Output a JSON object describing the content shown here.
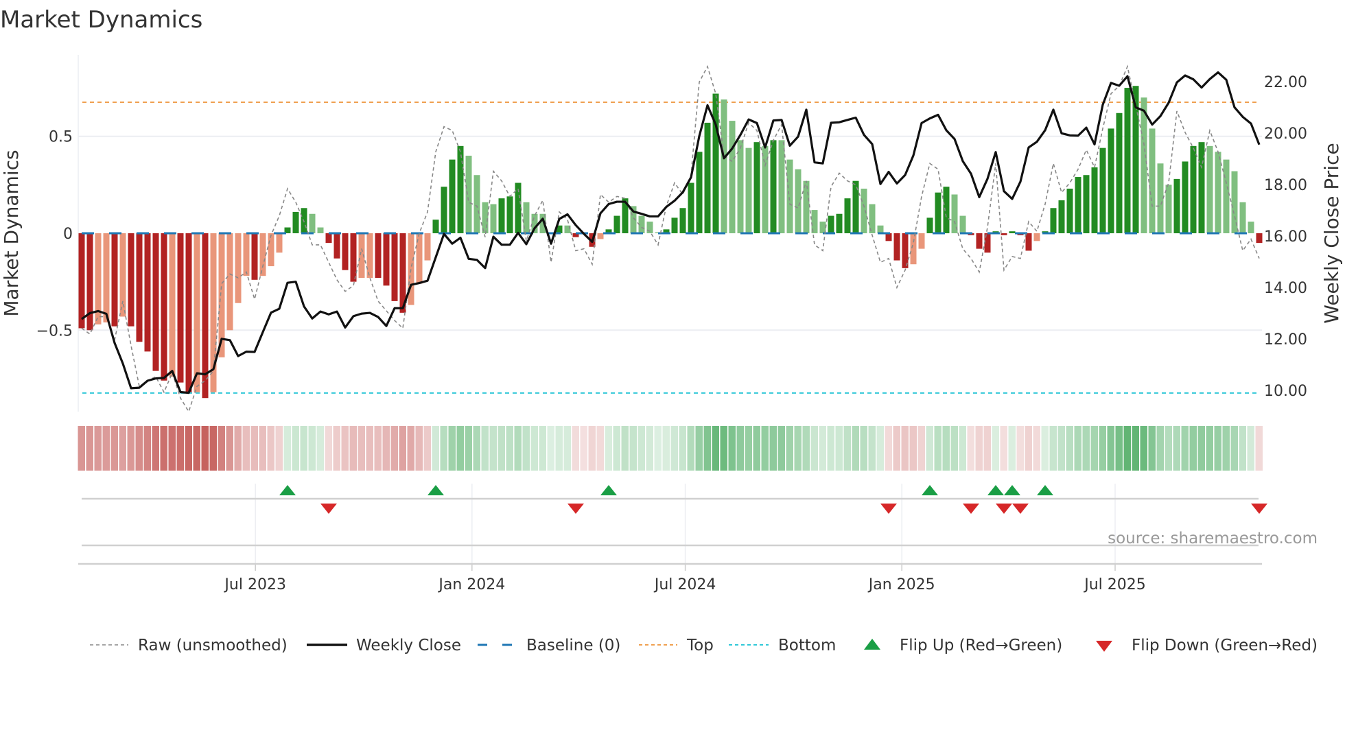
{
  "chart_data": {
    "type": "bar",
    "title": "Market Dynamics",
    "ylabel": "Market Dynamics",
    "y2label": "Weekly Close Price",
    "ylim": [
      -0.92,
      0.92
    ],
    "y2lim": [
      9.17,
      23.04
    ],
    "yticks": [
      {
        "v": 0.5,
        "label": "0.5"
      },
      {
        "v": 0,
        "label": "0"
      },
      {
        "v": -0.5,
        "label": "−0.5"
      }
    ],
    "y2ticks": [
      {
        "v": 22,
        "label": "22.00"
      },
      {
        "v": 20,
        "label": "20.00"
      },
      {
        "v": 18,
        "label": "18.00"
      },
      {
        "v": 16,
        "label": "16.00"
      },
      {
        "v": 14,
        "label": "14.00"
      },
      {
        "v": 12,
        "label": "12.00"
      },
      {
        "v": 10,
        "label": "10.00"
      }
    ],
    "xticks": [
      {
        "week": 21.1,
        "label": "Jul 2023"
      },
      {
        "week": 47.4,
        "label": "Jan 2024"
      },
      {
        "week": 73.3,
        "label": "Jul 2024"
      },
      {
        "week": 99.6,
        "label": "Jan 2025"
      },
      {
        "week": 125.5,
        "label": "Jul 2025"
      }
    ],
    "top_level": 0.676,
    "bottom_level": -0.824,
    "baseline": 0,
    "bars": [
      -0.49,
      -0.5,
      -0.47,
      -0.46,
      -0.48,
      -0.43,
      -0.48,
      -0.56,
      -0.61,
      -0.71,
      -0.76,
      -0.74,
      -0.77,
      -0.82,
      -0.82,
      -0.85,
      -0.82,
      -0.64,
      -0.5,
      -0.36,
      -0.22,
      -0.24,
      -0.22,
      -0.17,
      -0.1,
      0.03,
      0.11,
      0.13,
      0.1,
      0.03,
      -0.05,
      -0.13,
      -0.19,
      -0.25,
      -0.23,
      -0.23,
      -0.23,
      -0.27,
      -0.35,
      -0.41,
      -0.37,
      -0.26,
      -0.14,
      0.07,
      0.24,
      0.38,
      0.45,
      0.4,
      0.3,
      0.16,
      0.15,
      0.18,
      0.19,
      0.26,
      0.16,
      0.1,
      0.1,
      0.005,
      0.04,
      0.04,
      -0.02,
      -0.005,
      -0.07,
      -0.03,
      0.02,
      0.09,
      0.18,
      0.14,
      0.09,
      0.06,
      0.005,
      0.02,
      0.08,
      0.13,
      0.26,
      0.42,
      0.57,
      0.72,
      0.69,
      0.58,
      0.48,
      0.44,
      0.47,
      0.45,
      0.48,
      0.48,
      0.38,
      0.33,
      0.27,
      0.12,
      0.06,
      0.09,
      0.1,
      0.18,
      0.27,
      0.23,
      0.15,
      0.04,
      -0.04,
      -0.14,
      -0.18,
      -0.16,
      -0.08,
      0.08,
      0.21,
      0.24,
      0.2,
      0.09,
      -0.01,
      -0.08,
      -0.1,
      0.01,
      -0.01,
      0.01,
      -0.01,
      -0.09,
      -0.04,
      0.01,
      0.13,
      0.17,
      0.23,
      0.29,
      0.3,
      0.34,
      0.44,
      0.54,
      0.62,
      0.75,
      0.76,
      0.7,
      0.54,
      0.36,
      0.25,
      0.28,
      0.37,
      0.45,
      0.47,
      0.45,
      0.42,
      0.38,
      0.32,
      0.16,
      0.06,
      -0.05
    ],
    "bar_strong": [
      1,
      1,
      0,
      0,
      1,
      0,
      1,
      1,
      1,
      1,
      1,
      0,
      1,
      1,
      0,
      1,
      0,
      0,
      0,
      0,
      0,
      1,
      0,
      0,
      0,
      1,
      1,
      1,
      0,
      0,
      1,
      1,
      1,
      1,
      0,
      0,
      1,
      1,
      1,
      1,
      0,
      0,
      0,
      1,
      1,
      1,
      1,
      0,
      0,
      0,
      0,
      1,
      1,
      1,
      0,
      0,
      0,
      1,
      1,
      0,
      1,
      1,
      1,
      0,
      1,
      1,
      1,
      0,
      0,
      0,
      0,
      1,
      1,
      1,
      1,
      1,
      1,
      1,
      0,
      0,
      0,
      0,
      1,
      0,
      1,
      0,
      0,
      0,
      0,
      0,
      0,
      1,
      1,
      1,
      1,
      0,
      0,
      0,
      1,
      1,
      1,
      0,
      0,
      1,
      1,
      1,
      0,
      0,
      1,
      1,
      1,
      1,
      1,
      1,
      1,
      1,
      0,
      1,
      1,
      1,
      1,
      1,
      1,
      1,
      1,
      1,
      1,
      1,
      1,
      0,
      0,
      0,
      0,
      1,
      1,
      1,
      1,
      0,
      0,
      0,
      0,
      0,
      0,
      1
    ],
    "raw": [
      -0.49,
      -0.52,
      -0.43,
      -0.43,
      -0.55,
      -0.35,
      -0.58,
      -0.79,
      -0.76,
      -0.74,
      -0.82,
      -0.72,
      -0.85,
      -0.92,
      -0.79,
      -0.76,
      -0.71,
      -0.26,
      -0.21,
      -0.23,
      -0.2,
      -0.34,
      -0.17,
      -0.01,
      0.09,
      0.23,
      0.16,
      0.06,
      -0.06,
      -0.06,
      -0.15,
      -0.24,
      -0.3,
      -0.27,
      -0.08,
      -0.23,
      -0.35,
      -0.4,
      -0.45,
      -0.49,
      -0.18,
      0.0,
      0.11,
      0.42,
      0.55,
      0.53,
      0.42,
      0.16,
      0.14,
      -0.02,
      0.32,
      0.27,
      0.19,
      0.23,
      -0.04,
      0.09,
      0.17,
      -0.15,
      0.11,
      0.07,
      -0.09,
      -0.08,
      -0.16,
      0.2,
      0.16,
      0.19,
      0.18,
      0.08,
      0.03,
      0.01,
      -0.06,
      0.14,
      0.26,
      0.2,
      0.3,
      0.78,
      0.86,
      0.72,
      0.4,
      0.37,
      0.44,
      0.57,
      0.53,
      0.35,
      0.48,
      0.56,
      0.15,
      0.13,
      0.27,
      -0.06,
      -0.09,
      0.24,
      0.31,
      0.27,
      0.25,
      0.14,
      -0.01,
      -0.15,
      -0.13,
      -0.28,
      -0.19,
      -0.05,
      0.19,
      0.36,
      0.33,
      0.08,
      0.06,
      -0.08,
      -0.13,
      -0.2,
      0.03,
      0.36,
      -0.19,
      -0.12,
      -0.13,
      0.06,
      0.01,
      0.15,
      0.36,
      0.21,
      0.26,
      0.33,
      0.43,
      0.34,
      0.54,
      0.72,
      0.76,
      0.86,
      0.66,
      0.46,
      0.14,
      0.14,
      0.26,
      0.63,
      0.52,
      0.44,
      0.34,
      0.53,
      0.42,
      0.26,
      0.09,
      -0.09,
      -0.03,
      -0.13
    ],
    "weekly_close": [
      12.77,
      13.0,
      13.08,
      12.97,
      11.84,
      11.04,
      10.08,
      10.1,
      10.37,
      10.46,
      10.48,
      10.75,
      9.93,
      9.9,
      10.66,
      10.62,
      10.82,
      12.0,
      11.95,
      11.33,
      11.5,
      11.49,
      12.26,
      13.02,
      13.17,
      14.18,
      14.22,
      13.26,
      12.79,
      13.06,
      12.95,
      13.06,
      12.44,
      12.88,
      12.98,
      13.01,
      12.85,
      12.5,
      13.19,
      13.19,
      14.1,
      14.17,
      14.26,
      15.17,
      16.08,
      15.7,
      15.93,
      15.11,
      15.07,
      14.75,
      15.97,
      15.66,
      15.66,
      16.12,
      15.68,
      16.3,
      16.67,
      15.7,
      16.66,
      16.84,
      16.42,
      16.08,
      15.77,
      16.88,
      17.24,
      17.33,
      17.33,
      16.95,
      16.86,
      16.76,
      16.76,
      17.13,
      17.37,
      17.7,
      18.28,
      19.88,
      21.08,
      20.33,
      19.02,
      19.4,
      19.93,
      20.53,
      20.39,
      19.44,
      20.49,
      20.51,
      19.51,
      19.86,
      20.91,
      18.86,
      18.82,
      20.4,
      20.42,
      20.51,
      20.6,
      19.93,
      19.57,
      18.02,
      18.49,
      18.04,
      18.37,
      19.13,
      20.39,
      20.57,
      20.71,
      20.11,
      19.77,
      18.91,
      18.42,
      17.51,
      18.22,
      19.26,
      17.74,
      17.44,
      18.11,
      19.44,
      19.66,
      20.11,
      20.91,
      19.99,
      19.91,
      19.9,
      20.21,
      19.56,
      21.1,
      21.95,
      21.84,
      22.21,
      21.0,
      20.87,
      20.33,
      20.66,
      21.18,
      21.97,
      22.24,
      22.09,
      21.77,
      22.1,
      22.36,
      22.07,
      21.0,
      20.63,
      20.37,
      19.55
    ],
    "flip_up_weeks": [
      25,
      43,
      64,
      103,
      111,
      113,
      117
    ],
    "flip_down_weeks": [
      30,
      60,
      98,
      108,
      112,
      114,
      143
    ],
    "legend_position": "bottom",
    "legend": [
      {
        "key": "raw",
        "label": "Raw (unsmoothed)"
      },
      {
        "key": "close",
        "label": "Weekly Close"
      },
      {
        "key": "baseline",
        "label": "Baseline (0)"
      },
      {
        "key": "top",
        "label": "Top"
      },
      {
        "key": "bottom",
        "label": "Bottom"
      },
      {
        "key": "flip_up",
        "label": "Flip Up (Red→Green)"
      },
      {
        "key": "flip_down",
        "label": "Flip Down (Green→Red)"
      }
    ],
    "annotation": "source: sharemaestro.com",
    "colors": {
      "strong_red": "#b22222",
      "weak_red": "#e9967a",
      "strong_green": "#228b22",
      "weak_green": "#80bf80",
      "close": "#111111",
      "raw": "#888888",
      "baseline": "#1f77b4",
      "top": "#f0a050",
      "bottom": "#30c8d8",
      "flip_up": "#1a9e45",
      "flip_down": "#d62728"
    }
  }
}
